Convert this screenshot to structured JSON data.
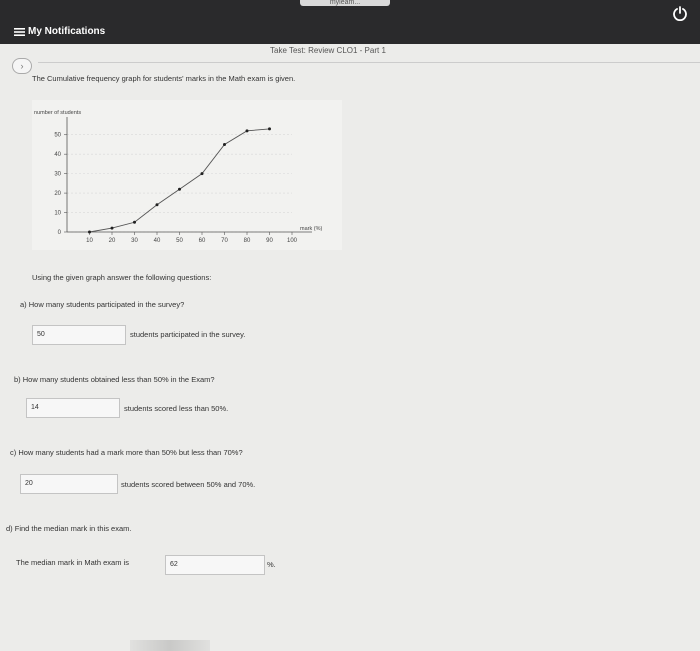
{
  "header": {
    "url_text": "myleam...",
    "app_title": "My Notifications"
  },
  "breadcrumb": "Take Test: Review CLO1 - Part 1",
  "intro": "The Cumulative frequency graph for students' marks in the Math exam is given.",
  "chart_data": {
    "type": "line",
    "ylabel": "number of students",
    "xlabel": "mark (%)",
    "x": [
      10,
      20,
      30,
      40,
      50,
      60,
      70,
      80,
      90,
      100
    ],
    "y": [
      0,
      2,
      5,
      14,
      22,
      30,
      45,
      52,
      53
    ],
    "x_points": [
      10,
      20,
      30,
      40,
      50,
      60,
      70,
      80,
      90
    ],
    "x_ticks": [
      "10",
      "20",
      "30",
      "40",
      "50",
      "60",
      "70",
      "80",
      "90",
      "100"
    ],
    "y_ticks": [
      "0",
      "10",
      "20",
      "30",
      "40",
      "50"
    ],
    "xlim": [
      0,
      100
    ],
    "ylim": [
      0,
      55
    ],
    "grid": true
  },
  "instructions": "Using the given graph answer the following questions:",
  "questions": [
    {
      "label": "a)  How many students participated in the survey?",
      "answer": "50",
      "after": "students participated in the survey."
    },
    {
      "label": "b)  How many students obtained less than 50% in the Exam?",
      "answer": "14",
      "after": "students scored less than 50%."
    },
    {
      "label": "c)  How many students had a mark more than 50% but less than 70%?",
      "answer": "20",
      "after": "students scored between 50% and 70%."
    },
    {
      "label": "d)  Find the median mark in this exam.",
      "prefix": "The median mark in Math exam is",
      "answer": "62",
      "after": "%."
    }
  ]
}
